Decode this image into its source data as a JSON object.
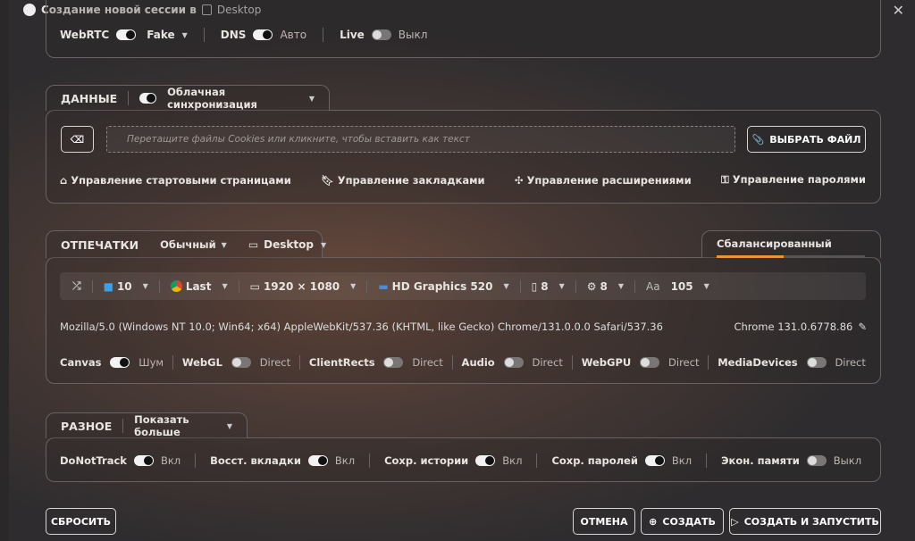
{
  "window": {
    "title": "Создание новой сессии в",
    "workspace": "Desktop"
  },
  "network": {
    "webrtc": {
      "label": "WebRTC",
      "on": true,
      "value": "Fake"
    },
    "dns": {
      "label": "DNS",
      "on": true,
      "value": "Авто"
    },
    "live": {
      "label": "Live",
      "on": false,
      "value": "Выкл"
    }
  },
  "data": {
    "header": "ДАННЫЕ",
    "sync_on": true,
    "sync_label": "Облачная синхронизация",
    "drop_placeholder": "Перетащите файлы Cookies или кликните, чтобы вставить как текст",
    "choose_file": "ВЫБРАТЬ ФАЙЛ",
    "links": [
      "Управление стартовыми страницами",
      "Управление закладками",
      "Управление расширениями",
      "Управление паролями"
    ]
  },
  "fingerprints": {
    "header": "ОТПЕЧАТКИ",
    "mode": "Обычный",
    "device": "Desktop",
    "profile_tab": "Сбалансированный",
    "profile_progress_percent": 45,
    "profile_color": "#e8963a",
    "os": "10",
    "browser": "Last",
    "resolution": "1920 × 1080",
    "gpu": "HD Graphics 520",
    "memory": "8",
    "cores": "8",
    "fonts": "105",
    "user_agent": "Mozilla/5.0 (Windows NT 10.0; Win64; x64) AppleWebKit/537.36 (KHTML, like Gecko) Chrome/131.0.0.0 Safari/537.36",
    "browser_version": "Chrome 131.0.6778.86",
    "toggles": [
      {
        "label": "Canvas",
        "on": true,
        "value": "Шум"
      },
      {
        "label": "WebGL",
        "on": false,
        "value": "Direct"
      },
      {
        "label": "ClientRects",
        "on": false,
        "value": "Direct"
      },
      {
        "label": "Audio",
        "on": false,
        "value": "Direct"
      },
      {
        "label": "WebGPU",
        "on": false,
        "value": "Direct"
      },
      {
        "label": "MediaDevices",
        "on": false,
        "value": "Direct"
      }
    ]
  },
  "misc": {
    "header": "РАЗНОЕ",
    "show_more": "Показать больше",
    "toggles": [
      {
        "label": "DoNotTrack",
        "on": true,
        "value": "Вкл"
      },
      {
        "label": "Восст. вкладки",
        "on": true,
        "value": "Вкл"
      },
      {
        "label": "Сохр. истории",
        "on": true,
        "value": "Вкл"
      },
      {
        "label": "Сохр. паролей",
        "on": true,
        "value": "Вкл"
      },
      {
        "label": "Экон. памяти",
        "on": false,
        "value": "Выкл"
      }
    ]
  },
  "footer": {
    "reset": "СБРОСИТЬ",
    "cancel": "ОТМЕНА",
    "create": "СОЗДАТЬ",
    "create_launch": "СОЗДАТЬ И ЗАПУСТИТЬ"
  }
}
